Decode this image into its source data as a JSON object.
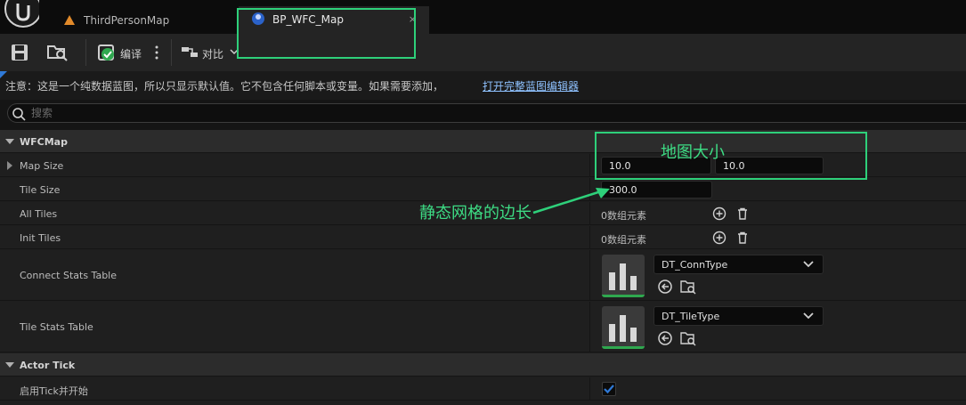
{
  "tabs": [
    {
      "label": "ThirdPersonMap"
    },
    {
      "label": "BP_WFC_Map",
      "close": "×"
    }
  ],
  "toolbar": {
    "compile_label": "编译",
    "diff_label": "对比"
  },
  "notice": {
    "text": "注意：这是一个纯数据蓝图，所以只显示默认值。它不包含任何脚本或变量。如果需要添加，",
    "link": "打开完整蓝图编辑器"
  },
  "search": {
    "placeholder": "搜索",
    "value": ""
  },
  "categories": {
    "wfc": "WFCMap",
    "tick": "Actor Tick"
  },
  "properties": {
    "map_size": {
      "name": "Map Size",
      "x": "10.0",
      "y": "10.0"
    },
    "tile_size": {
      "name": "Tile Size",
      "value": "300.0"
    },
    "all_tiles": {
      "name": "All Tiles",
      "count": "0数组元素"
    },
    "init_tiles": {
      "name": "Init Tiles",
      "count": "0数组元素"
    },
    "connect_stats": {
      "name": "Connect Stats Table",
      "asset": "DT_ConnType"
    },
    "tile_stats": {
      "name": "Tile Stats Table",
      "asset": "DT_TileType"
    },
    "tick_start": {
      "name": "启用Tick并开始",
      "checked": true
    }
  },
  "annotations": {
    "map_size": "地图大小",
    "tile_edge": "静态网格的边长"
  },
  "colors": {
    "accent_link": "#8fc2ff",
    "annotation": "#3ddc84",
    "asset_underline": "#2fa84f",
    "checkbox": "#2f7ad8"
  }
}
